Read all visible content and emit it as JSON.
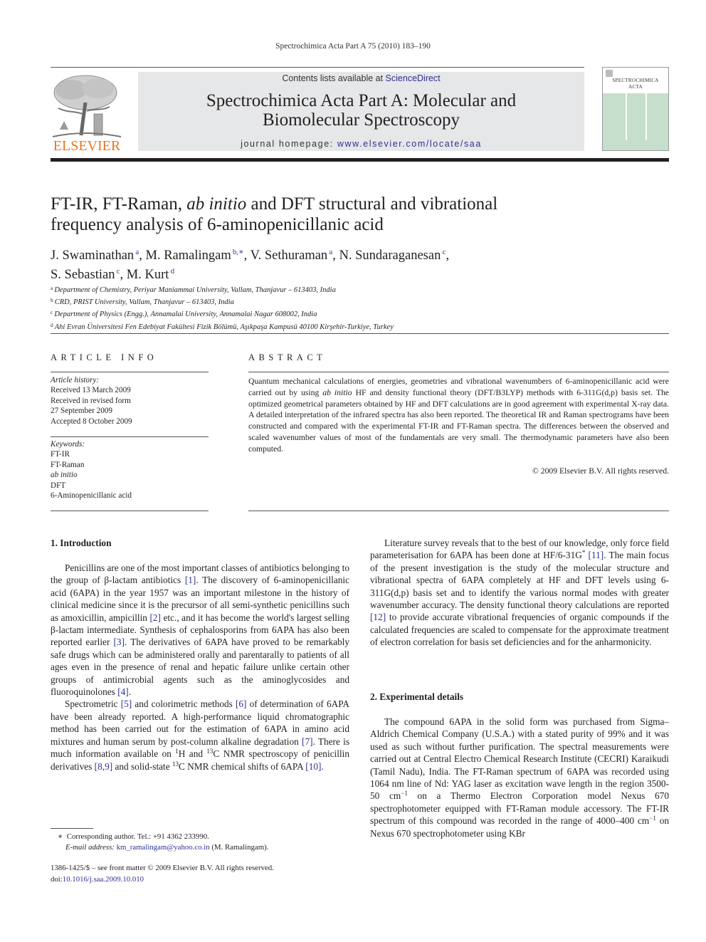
{
  "running_header": "Spectrochimica Acta Part A 75 (2010) 183–190",
  "masthead": {
    "publisher": "ELSEVIER",
    "contents_prefix": "Contents lists available at ",
    "contents_link": "ScienceDirect",
    "journal_title_line1": "Spectrochimica Acta Part A: Molecular and",
    "journal_title_line2": "Biomolecular Spectroscopy",
    "homepage_prefix": "journal homepage: ",
    "homepage_link": "www.elsevier.com/locate/saa",
    "cover_title_line1": "SPECTROCHIMICA",
    "cover_title_line2": "ACTA",
    "link_color": "#2e3192",
    "publisher_color": "#e87722",
    "cover_color": "#c6dfcc"
  },
  "article": {
    "title_part1": "FT-IR, FT-Raman, ",
    "title_italic": "ab initio",
    "title_part2": " and DFT structural and vibrational frequency analysis of 6-aminopenicillanic acid",
    "authors": [
      {
        "name": "J. Swaminathan",
        "aff": "a",
        "sep": ", "
      },
      {
        "name": "M. Ramalingam",
        "aff": "b,∗",
        "sep": ", "
      },
      {
        "name": "V. Sethuraman",
        "aff": "a",
        "sep": ", "
      },
      {
        "name": "N. Sundaraganesan",
        "aff": "c",
        "sep": ","
      },
      {
        "name": "S. Sebastian",
        "aff": "c",
        "sep": ", "
      },
      {
        "name": "M. Kurt",
        "aff": "d",
        "sep": ""
      }
    ],
    "affiliations": [
      {
        "key": "a",
        "text": "Department of Chemistry, Periyar Maniammai University, Vallam, Thanjavur – 613403, India"
      },
      {
        "key": "b",
        "text": "CRD, PRIST University, Vallam, Thanjavur – 613403, India"
      },
      {
        "key": "c",
        "text": "Department of Physics (Engg.), Annamalai University, Annamalai Nagar 608002, India"
      },
      {
        "key": "d",
        "text": "Ahi Evran Üniversitesi Fen Edebiyat Fakültesi Fizik Bölümü, Aşıkpaşa Kampusü 40100 Kirşehir-Turkiye, Turkey"
      }
    ]
  },
  "article_info": {
    "heading": "ARTICLE INFO",
    "history_label": "Article history:",
    "history": [
      "Received 13 March 2009",
      "Received in revised form",
      "27 September 2009",
      "Accepted 8 October 2009"
    ],
    "keywords_label": "Keywords:",
    "keywords": [
      "FT-IR",
      "FT-Raman",
      "ab initio",
      "DFT",
      "6-Aminopenicillanic acid"
    ]
  },
  "abstract": {
    "heading": "ABSTRACT",
    "text_before_italic": "Quantum mechanical calculations of energies, geometries and vibrational wavenumbers of 6-aminopenicillanic acid were carried out by using ",
    "italic": "ab initio",
    "text_after_italic": " HF and density functional theory (DFT/B3LYP) methods with 6-311G(d,p) basis set. The optimized geometrical parameters obtained by HF and DFT calculations are in good agreement with experimental X-ray data. A detailed interpretation of the infrared spectra has also been reported. The theoretical IR and Raman spectrograms have been constructed and compared with the experimental FT-IR and FT-Raman spectra. The differences between the observed and scaled wavenumber values of most of the fundamentals are very small. The thermodynamic parameters have also been computed.",
    "copyright": "© 2009 Elsevier B.V. All rights reserved."
  },
  "sections": {
    "intro_heading": "1.  Introduction",
    "intro_p1": [
      "Penicillins are one of the most important classes of antibiotics belonging to the group of β-lactam antibiotics ",
      "[1]",
      ". The discovery of 6-aminopenicillanic acid (6APA) in the year 1957 was an important milestone in the history of clinical medicine since it is the precursor of all semi-synthetic penicillins such as amoxicillin, ampicillin ",
      "[2]",
      " etc., and it has become the world's largest selling β-lactam intermediate. Synthesis of cephalosporins from 6APA has also been reported earlier ",
      "[3]",
      ". The derivatives of 6APA have proved to be remarkably safe drugs which can be administered orally and parentarally to patients of all ages even in the presence of renal and hepatic failure unlike certain other groups of antimicrobial agents such as the aminoglycosides and fluoroquinolones ",
      "[4]",
      "."
    ],
    "intro_p2": [
      "Spectrometric ",
      "[5]",
      " and colorimetric methods ",
      "[6]",
      " of determination of 6APA have been already reported. A high-performance liquid chromatographic method has been carried out for the estimation of 6APA in amino acid mixtures and human serum by post-column alkaline degradation ",
      "[7]",
      ". There is much information available on ",
      "1",
      "H and ",
      "13",
      "C NMR spectroscopy of penicillin derivatives ",
      "[8,9]",
      " and solid-state ",
      "13",
      "C NMR chemical shifts of 6APA ",
      "[10]",
      "."
    ],
    "lit_p": [
      "Literature survey reveals that to the best of our knowledge, only force field parameterisation for 6APA has been done at HF/6-31G",
      "*",
      " ",
      "[11]",
      ". The main focus of the present investigation is the study of the molecular structure and vibrational spectra of 6APA completely at HF and DFT levels using 6-311G(d,p) basis set and to identify the various normal modes with greater wavenumber accuracy. The density functional theory calculations are reported ",
      "[12]",
      " to provide accurate vibrational frequencies of organic compounds if the calculated frequencies are scaled to compensate for the approximate treatment of electron correlation for basis set deficiencies and for the anharmonicity."
    ],
    "exp_heading": "2.  Experimental details",
    "exp_p": [
      "The compound 6APA in the solid form was purchased from Sigma–Aldrich Chemical Company (U.S.A.) with a stated purity of 99% and it was used as such without further purification. The spectral measurements were carried out at Central Electro Chemical Research Institute (CECRI) Karaikudi (Tamil Nadu), India. The FT-Raman spectrum of 6APA was recorded using 1064 nm line of Nd: YAG laser as excitation wave length in the region 3500-50 cm",
      "−1",
      " on a Thermo Electron Corporation model Nexus 670 spectrophotometer equipped with FT-Raman module accessory. The FT-IR spectrum of this compound was recorded in the range of 4000–400 cm",
      "−1",
      " on Nexus 670 spectrophotometer using KBr"
    ]
  },
  "footnotes": {
    "star": "∗",
    "corresponding": "Corresponding author. Tel.: +91 4362 233990.",
    "email_label": "E-mail address: ",
    "email": "km_ramalingam@yahoo.co.in",
    "email_suffix": " (M. Ramalingam).",
    "front_matter": "1386-1425/$ – see front matter © 2009 Elsevier B.V. All rights reserved.",
    "doi_label": "doi:",
    "doi": "10.1016/j.saa.2009.10.010"
  }
}
